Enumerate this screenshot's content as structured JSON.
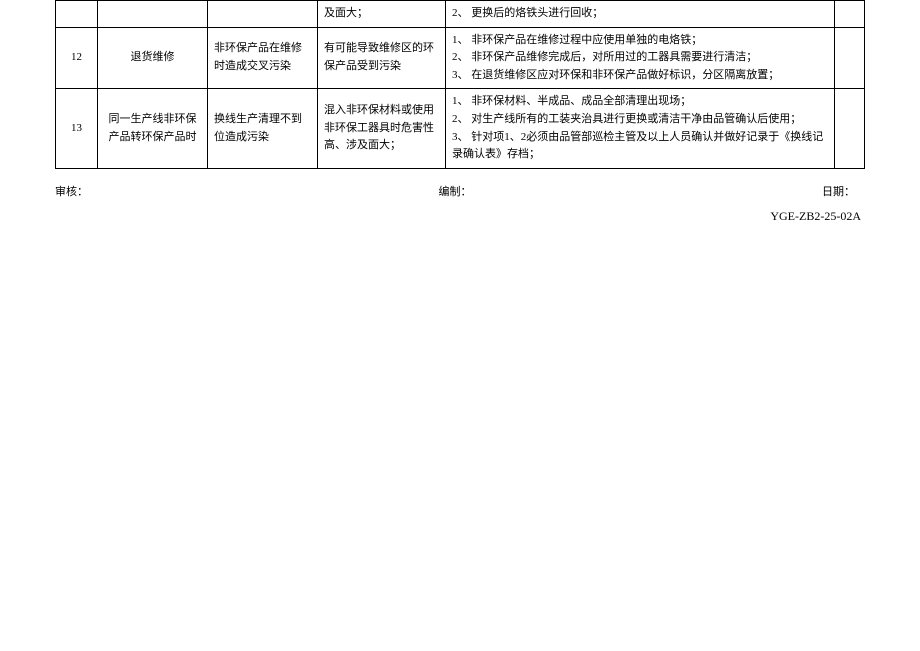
{
  "table": {
    "rows": [
      {
        "num": "",
        "proc": "",
        "cause": "",
        "risk": "及面大；",
        "measures": "2、 更换后的烙铁头进行回收；",
        "end": ""
      },
      {
        "num": "12",
        "proc": "退货维修",
        "cause": "非环保产品在维修时造成交叉污染",
        "risk": "有可能导致维修区的环保产品受到污染",
        "measures_lines": [
          "1、 非环保产品在维修过程中应使用单独的电烙铁；",
          "2、 非环保产品维修完成后，对所用过的工器具需要进行清洁；",
          "3、 在退货维修区应对环保和非环保产品做好标识，分区隔离放置；"
        ],
        "end": ""
      },
      {
        "num": "13",
        "proc": "同一生产线非环保产品转环保产品时",
        "cause": "换线生产清理不到位造成污染",
        "risk": "混入非环保材料或使用非环保工器具时危害性高、涉及面大；",
        "measures_lines": [
          "1、 非环保材料、半成品、成品全部清理出现场；",
          "2、 对生产线所有的工装夹治具进行更换或清洁干净由品管确认后使用；",
          "3、 针对项1、2必须由品管部巡检主管及以上人员确认并做好记录于《换线记录确认表》存档；"
        ],
        "end": ""
      }
    ]
  },
  "footer": {
    "audit": "审核：",
    "compiled": "编制：",
    "date": "日期："
  },
  "doc_code": "YGE-ZB2-25-02A"
}
